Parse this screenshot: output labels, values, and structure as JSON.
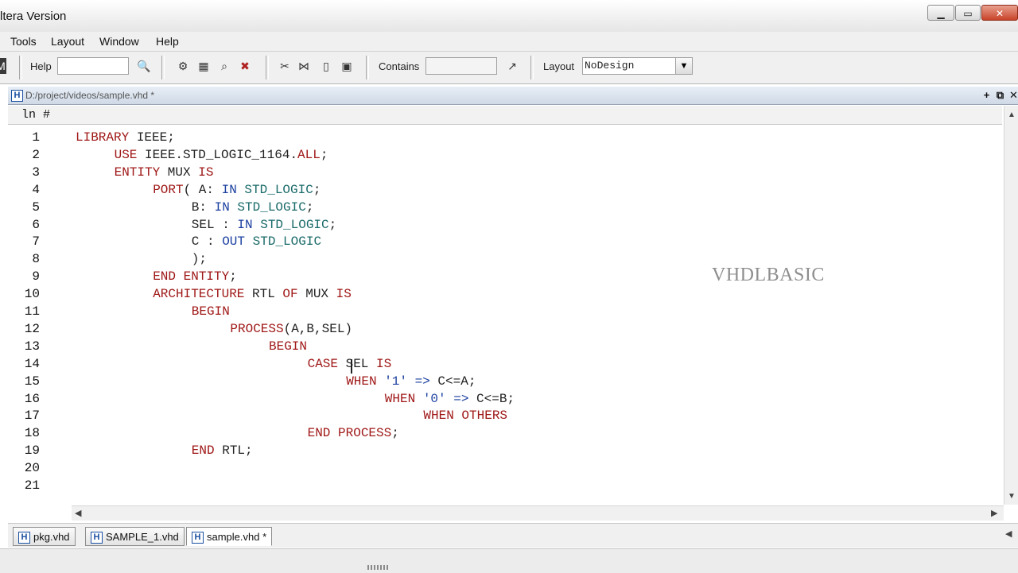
{
  "window": {
    "title": "ltera Version",
    "controls": {
      "minimize": "▁",
      "maximize": "▭",
      "close": "✕"
    }
  },
  "menu": [
    "Tools",
    "Layout",
    "Window",
    "Help"
  ],
  "toolbar": {
    "help_label": "Help",
    "help_value": "",
    "contains_label": "Contains",
    "contains_value": "",
    "layout_label": "Layout",
    "layout_value": "NoDesign"
  },
  "document": {
    "path": "D:/project/videos/sample.vhd *",
    "header": "ln #"
  },
  "code": [
    {
      "n": "1",
      "indent": 0,
      "tokens": [
        [
          "kw",
          "LIBRARY"
        ],
        [
          "id",
          " IEEE;"
        ]
      ]
    },
    {
      "n": "2",
      "indent": 4,
      "tokens": [
        [
          "kw",
          "USE"
        ],
        [
          "id",
          " IEEE.STD_LOGIC_1164."
        ],
        [
          "kw",
          "ALL"
        ],
        [
          "id",
          ";"
        ]
      ]
    },
    {
      "n": "3",
      "indent": 4,
      "tokens": [
        [
          "kw",
          "ENTITY"
        ],
        [
          "id",
          " MUX "
        ],
        [
          "kw",
          "IS"
        ]
      ]
    },
    {
      "n": "4",
      "indent": 8,
      "tokens": [
        [
          "kw",
          "PORT"
        ],
        [
          "id",
          "( A: "
        ],
        [
          "lt",
          "IN"
        ],
        [
          "id",
          " "
        ],
        [
          "ty",
          "STD_LOGIC"
        ],
        [
          "id",
          ";"
        ]
      ]
    },
    {
      "n": "5",
      "indent": 12,
      "tokens": [
        [
          "id",
          "B: "
        ],
        [
          "lt",
          "IN"
        ],
        [
          "id",
          " "
        ],
        [
          "ty",
          "STD_LOGIC"
        ],
        [
          "id",
          ";"
        ]
      ]
    },
    {
      "n": "6",
      "indent": 12,
      "tokens": [
        [
          "id",
          "SEL : "
        ],
        [
          "lt",
          "IN"
        ],
        [
          "id",
          " "
        ],
        [
          "ty",
          "STD_LOGIC"
        ],
        [
          "id",
          ";"
        ]
      ]
    },
    {
      "n": "7",
      "indent": 12,
      "tokens": [
        [
          "id",
          "C : "
        ],
        [
          "lt",
          "OUT"
        ],
        [
          "id",
          " "
        ],
        [
          "ty",
          "STD_LOGIC"
        ]
      ]
    },
    {
      "n": "8",
      "indent": 12,
      "tokens": [
        [
          "id",
          ");"
        ]
      ]
    },
    {
      "n": "9",
      "indent": 8,
      "tokens": [
        [
          "kw",
          "END"
        ],
        [
          "id",
          " "
        ],
        [
          "kw",
          "ENTITY"
        ],
        [
          "id",
          ";"
        ]
      ]
    },
    {
      "n": "10",
      "indent": 8,
      "tokens": [
        [
          "kw",
          "ARCHITECTURE"
        ],
        [
          "id",
          " RTL "
        ],
        [
          "kw",
          "OF"
        ],
        [
          "id",
          " MUX "
        ],
        [
          "kw",
          "IS"
        ]
      ]
    },
    {
      "n": "11",
      "indent": 12,
      "tokens": [
        [
          "kw",
          "BEGIN"
        ]
      ]
    },
    {
      "n": "12",
      "indent": 16,
      "tokens": [
        [
          "kw",
          "PROCESS"
        ],
        [
          "id",
          "(A,B,SEL)"
        ]
      ]
    },
    {
      "n": "13",
      "indent": 20,
      "tokens": [
        [
          "kw",
          "BEGIN"
        ]
      ]
    },
    {
      "n": "14",
      "indent": 24,
      "tokens": [
        [
          "kw",
          "CASE"
        ],
        [
          "id",
          " SEL "
        ],
        [
          "kw",
          "IS"
        ]
      ]
    },
    {
      "n": "15",
      "indent": 28,
      "tokens": [
        [
          "kw",
          "WHEN"
        ],
        [
          "id",
          " "
        ],
        [
          "lt",
          "'1'"
        ],
        [
          "id",
          " "
        ],
        [
          "lt",
          "=>"
        ],
        [
          "id",
          " C<=A;"
        ]
      ]
    },
    {
      "n": "16",
      "indent": 32,
      "tokens": [
        [
          "kw",
          "WHEN"
        ],
        [
          "id",
          " "
        ],
        [
          "lt",
          "'0'"
        ],
        [
          "id",
          " "
        ],
        [
          "lt",
          "=>"
        ],
        [
          "id",
          " C<=B;"
        ]
      ]
    },
    {
      "n": "17",
      "indent": 36,
      "tokens": [
        [
          "kw",
          "WHEN"
        ],
        [
          "id",
          " "
        ],
        [
          "kw",
          "OTHERS"
        ]
      ]
    },
    {
      "n": "18",
      "indent": 24,
      "tokens": [
        [
          "kw",
          "END"
        ],
        [
          "id",
          " "
        ],
        [
          "kw",
          "PROCESS"
        ],
        [
          "id",
          ";"
        ]
      ]
    },
    {
      "n": "19",
      "indent": 12,
      "tokens": [
        [
          "kw",
          "END"
        ],
        [
          "id",
          " RTL;"
        ]
      ]
    },
    {
      "n": "20",
      "indent": 0,
      "tokens": []
    },
    {
      "n": "21",
      "indent": 0,
      "tokens": []
    }
  ],
  "watermark": "VHDLBASIC",
  "tabs": [
    {
      "label": "pkg.vhd",
      "active": false
    },
    {
      "label": "SAMPLE_1.vhd",
      "active": false
    },
    {
      "label": "sample.vhd *",
      "active": true
    }
  ],
  "icons": {
    "file_type": "H"
  }
}
